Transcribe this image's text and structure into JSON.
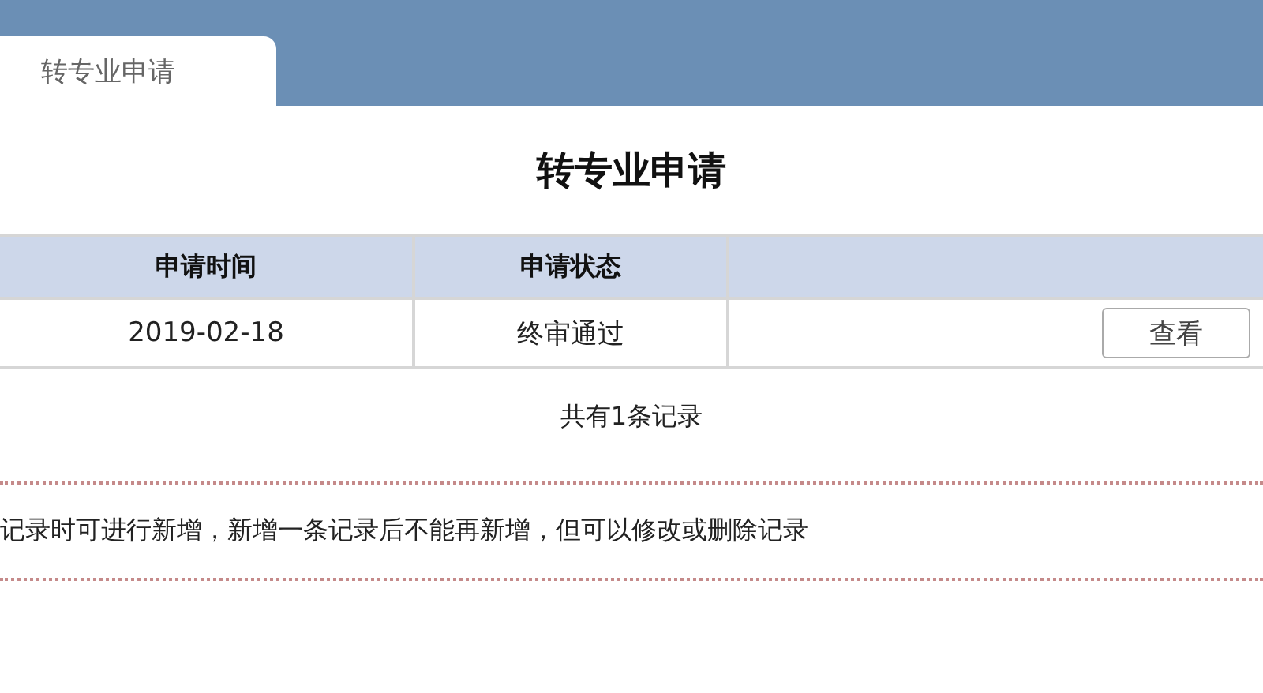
{
  "tabs": [
    {
      "label": "转专业申请",
      "selected": true
    }
  ],
  "title": "转专业申请",
  "table": {
    "columns": [
      "申请时间",
      "申请状态",
      ""
    ],
    "rows": [
      {
        "cells": [
          "2019-02-18",
          "终审通过"
        ],
        "action": "查看"
      }
    ]
  },
  "record_count": "共有1条记录",
  "note": "记录时可进行新增，新增一条记录后不能再新增，但可以修改或删除记录"
}
